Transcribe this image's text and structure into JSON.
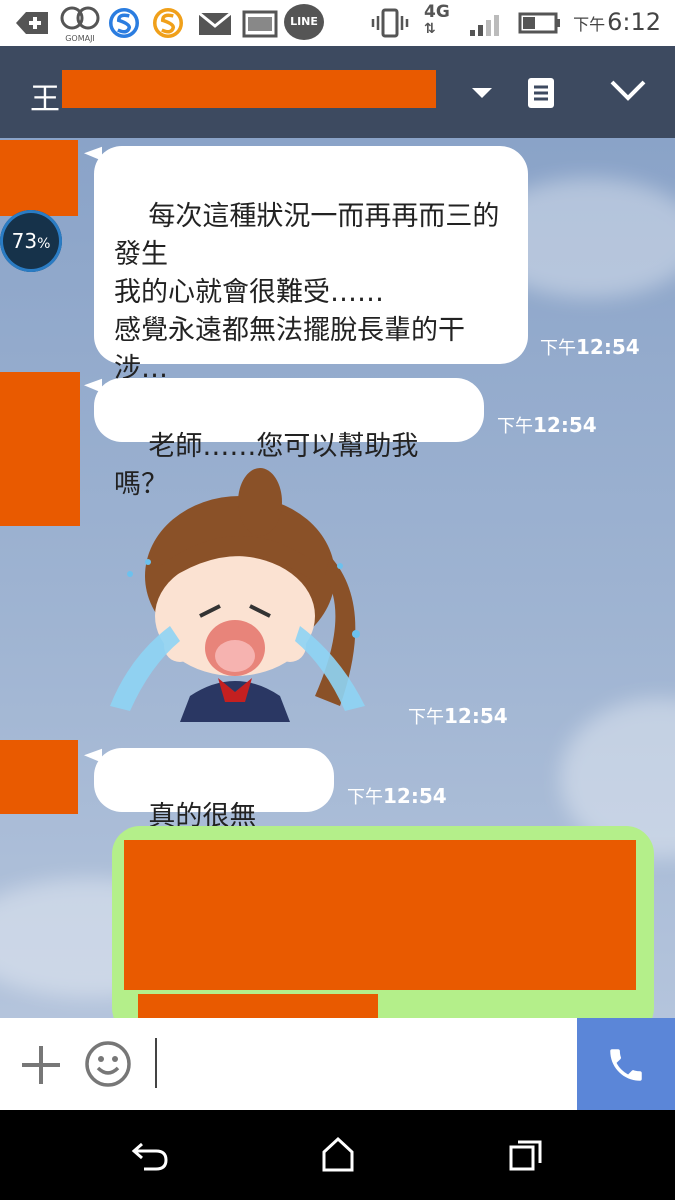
{
  "status_bar": {
    "time_prefix": "下午",
    "time": "6:12",
    "network": "4G",
    "app_icons": [
      "add-icon",
      "gomaji-icon",
      "s-blue-icon",
      "s-orange-icon",
      "mail-icon",
      "image-icon",
      "line-icon"
    ],
    "gomaji_label": "GOMAJI",
    "line_label": "LINE"
  },
  "header": {
    "title_char": "王"
  },
  "battery_widget": {
    "percent": "73",
    "unit": "%"
  },
  "messages": [
    {
      "text": "每次這種狀況一而再再而三的\n發生\n我的心就會很難受……\n感覺永遠都無法擺脫長輩的干\n涉…",
      "time_prefix": "下午",
      "time": "12:54"
    },
    {
      "text": "老師……您可以幫助我嗎？",
      "time_prefix": "下午",
      "time": "12:54"
    },
    {
      "sticker": "crying-girl-sticker",
      "time_prefix": "下午",
      "time": "12:54"
    },
    {
      "text": "真的很無助……",
      "time_prefix": "下午",
      "time": "12:54"
    }
  ],
  "colors": {
    "redaction": "#e95a00",
    "header_bg": "#3d4a60",
    "outgoing_bubble": "#b4ef8a",
    "call_button": "#5b86d8"
  }
}
